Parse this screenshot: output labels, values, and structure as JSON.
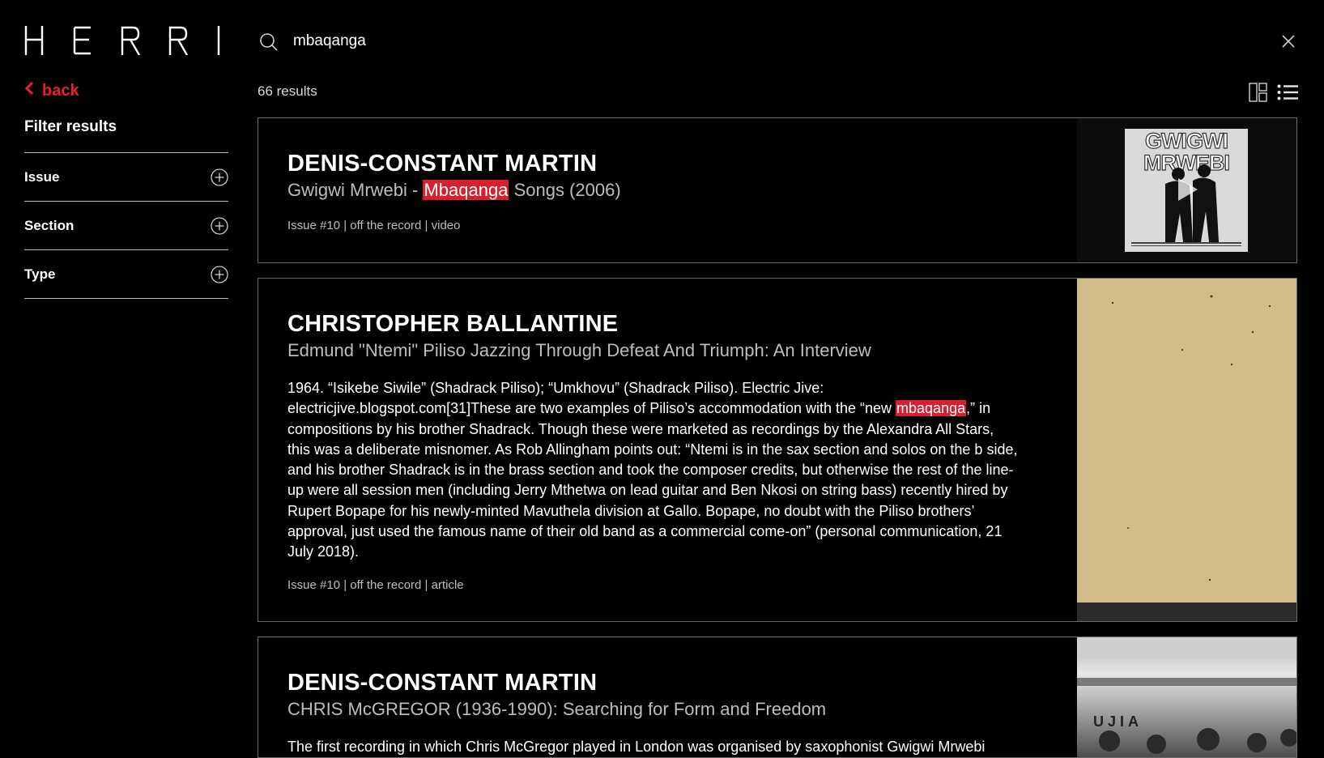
{
  "brand": {
    "logo_text": "HERRI"
  },
  "search": {
    "value": "mbaqanga",
    "placeholder": ""
  },
  "sidebar": {
    "back_label": "back",
    "filter_title": "Filter results",
    "filters": [
      {
        "label": "Issue"
      },
      {
        "label": "Section"
      },
      {
        "label": "Type"
      }
    ]
  },
  "results": {
    "count_label": "66 results",
    "items": [
      {
        "author": "DENIS-CONSTANT MARTIN",
        "title_before": "Gwigwi Mrwebi - ",
        "title_highlight": "Mbaqanga",
        "title_after": " Songs (2006)",
        "meta": "Issue #10 | off the record | video",
        "thumbnail": {
          "album_title_line1": "GWIGWI",
          "album_title_line2": "MRWEBI",
          "icon": "play-icon"
        }
      },
      {
        "author": "CHRISTOPHER BALLANTINE",
        "title": "Edmund \"Ntemi\" Piliso Jazzing Through Defeat And Triumph: An Interview",
        "excerpt_before": "1964. “Isikebe Siwile” (Shadrack Piliso); “Umkhovu” (Shadrack Piliso). Electric Jive: electricjive.blogspot.com[31]These are two examples of Piliso’s accommodation with the “new ",
        "excerpt_highlight": "mbaqanga",
        "excerpt_after": ",” in compositions by his brother Shadrack. Though these were marketed as recordings by the Alexandra All Stars, this was a deliberate misnomer. As Rob Allingham points out: “Ntemi is in the sax section and solos on the b side, and his brother Shadrack is in the brass section and took the composer credits, but otherwise the rest of the line-up were all session men (including Jerry Mthetwa on lead guitar and Ben Nkosi on string bass) recently hired by Rupert Bopape for his newly-minted Mavuthela division at Gallo. Bopape, no doubt with the Piliso brothers’ approval, just used the famous name of their old band as a commercial come-on” (personal communication, 21 July 2018).",
        "meta": "Issue #10 | off the record | article"
      },
      {
        "author": "DENIS-CONSTANT MARTIN",
        "title": "CHRIS McGREGOR (1936-1990): Searching for Form and Freedom",
        "excerpt": "The first recording in which Chris McGregor played in London was organised by saxophonist Gwigwi Mrwebi",
        "photo_text": "UJIA"
      }
    ]
  },
  "colors": {
    "accent": "#e8202e",
    "highlight": "#d6202f",
    "tan_thumbnail": "#d3bc89"
  },
  "icons": [
    "search-icon",
    "close-icon",
    "chevron-left-icon",
    "plus-circle-icon",
    "grid-view-icon",
    "list-view-icon",
    "play-icon"
  ]
}
